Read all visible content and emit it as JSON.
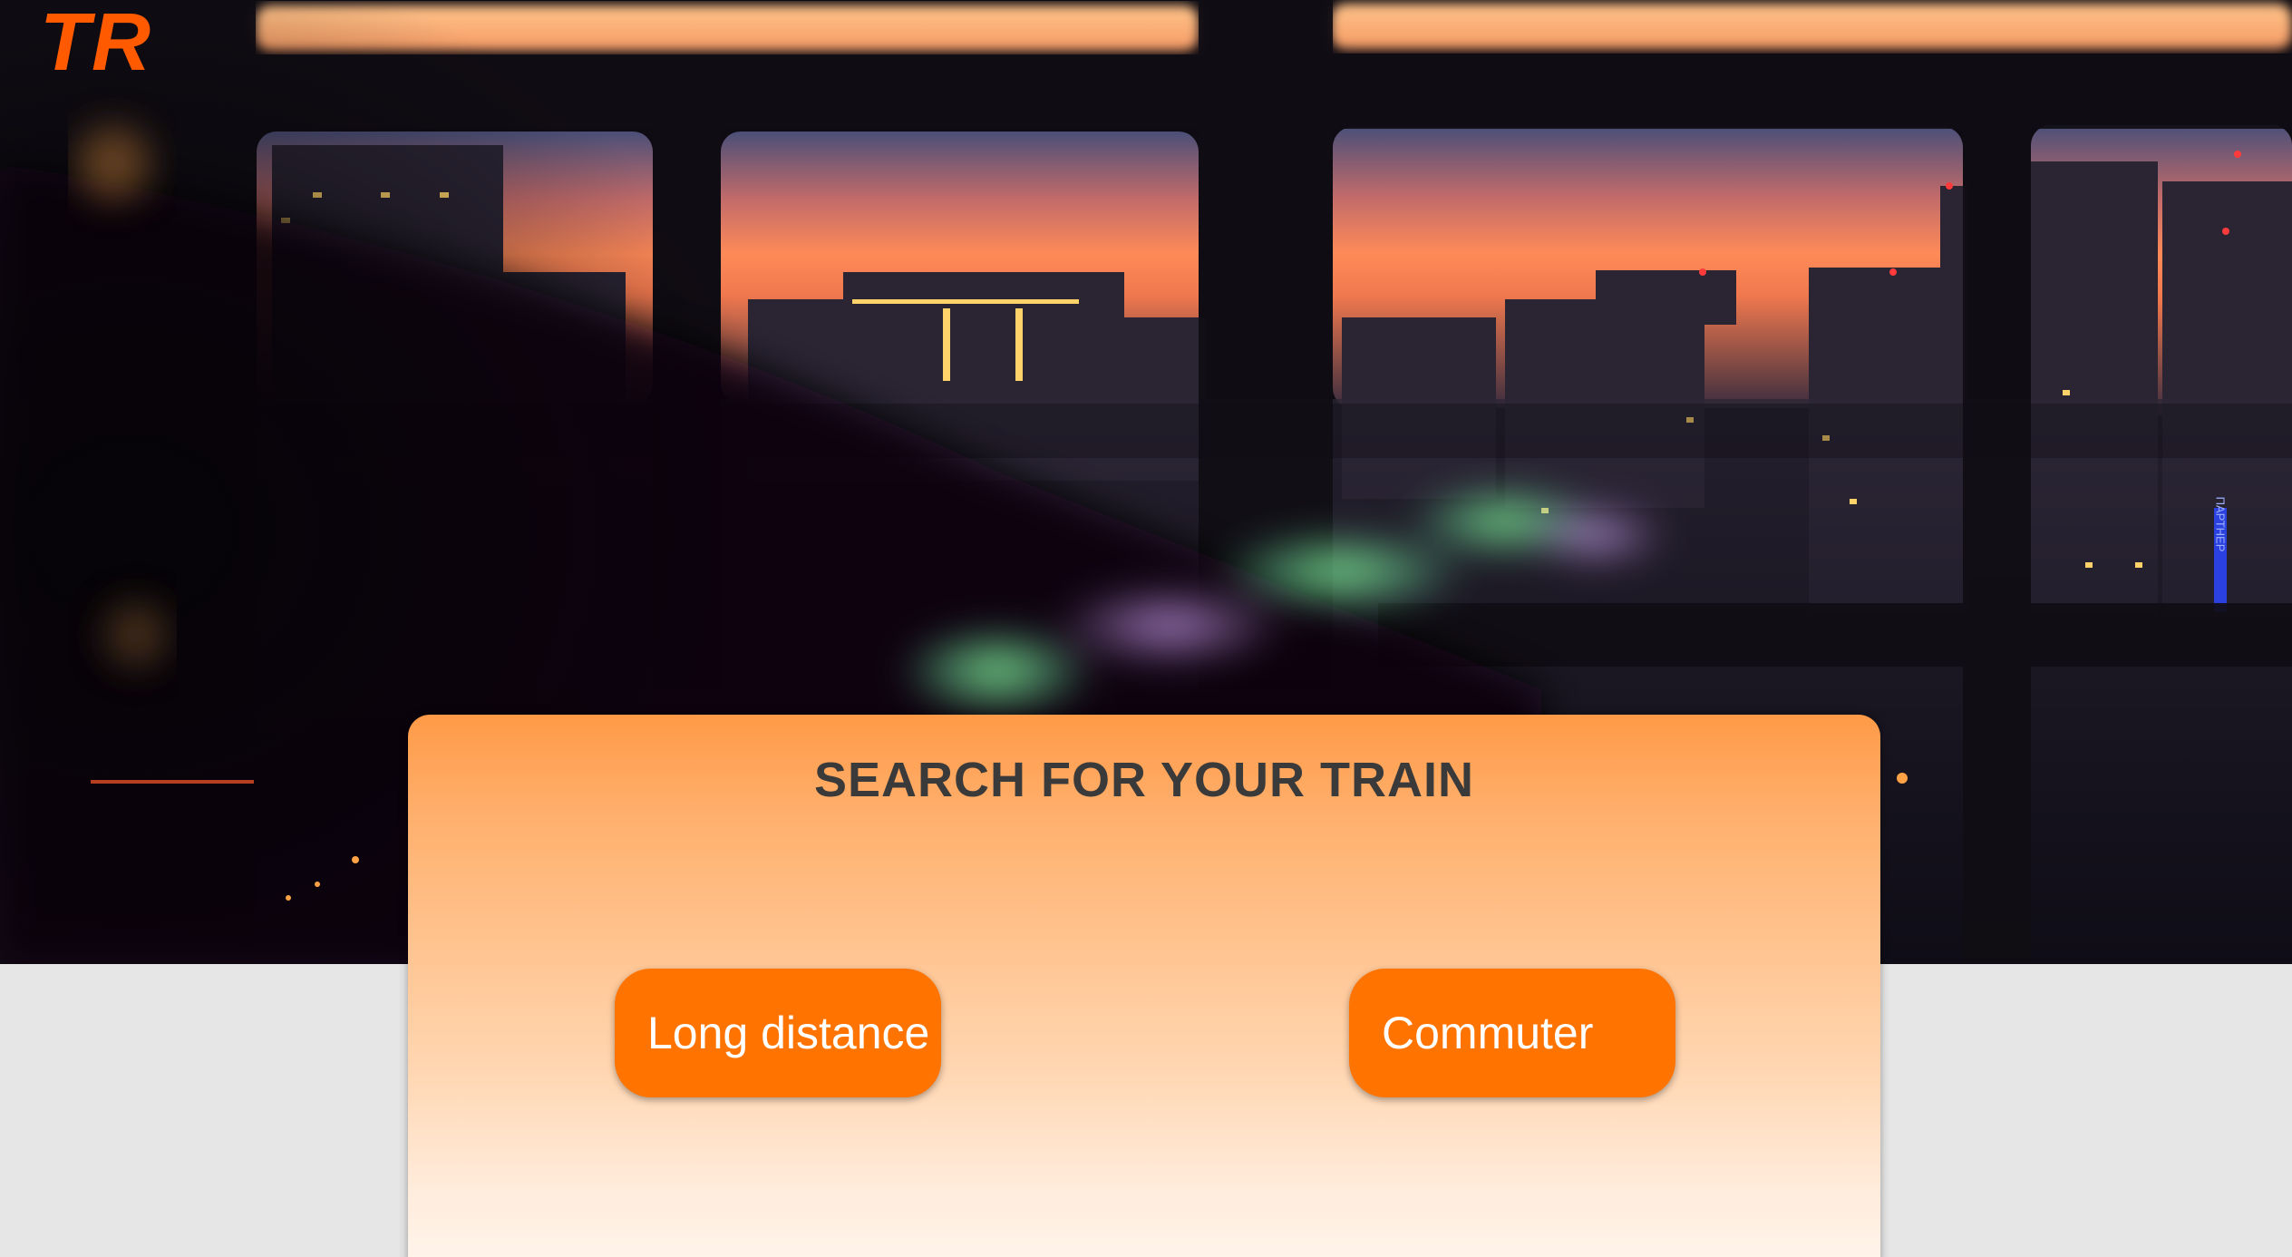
{
  "logo": {
    "text": "TR",
    "color": "#ff5a00"
  },
  "hero": {
    "image": "blurred-city-sunset-window",
    "sign_text": "ПАРТНЕР"
  },
  "search": {
    "title": "SEARCH FOR YOUR TRAIN",
    "options": [
      {
        "label": "Long distance"
      },
      {
        "label": "Commuter"
      }
    ]
  },
  "colors": {
    "accent": "#ff7300",
    "card_top": "#ff9a47",
    "card_bottom": "#fff8f2",
    "title": "#3a3a3a",
    "page_background": "#e6e6e6"
  }
}
